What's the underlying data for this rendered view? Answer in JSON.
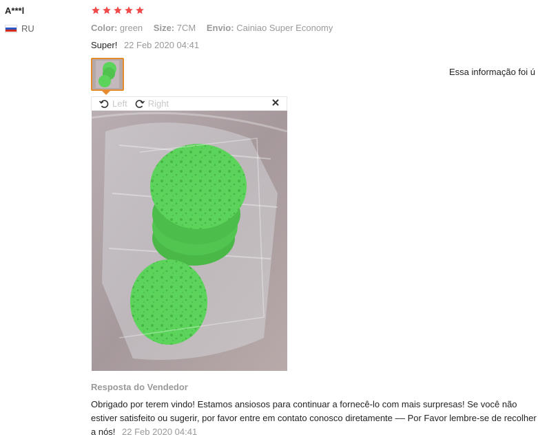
{
  "review": {
    "user_name": "A***l",
    "country": "RU",
    "rating": 5,
    "attributes": [
      {
        "key": "Color:",
        "value": "green"
      },
      {
        "key": "Size:",
        "value": "7CM"
      },
      {
        "key": "Envio:",
        "value": "Cainiao Super Economy"
      }
    ],
    "feedback_text": "Super!",
    "feedback_date": "22 Feb 2020 04:41"
  },
  "helpful_text": "Essa informação foi ú",
  "viewer": {
    "rotate_left_label": "Left",
    "rotate_right_label": "Right"
  },
  "seller_reply": {
    "title": "Resposta do Vendedor",
    "text": "Obrigado por terem vindo! Estamos ansiosos para continuar a fornecê-lo com mais surpresas! Se você não estiver satisfeito ou sugerir, por favor entre em contato conosco diretamente –– Por Favor lembre-se de recolher a nós!",
    "date": "22 Feb 2020 04:41"
  },
  "colors": {
    "star": "#f04a4a",
    "thumb_border": "#e68a2e",
    "muted_text": "#999999",
    "sponge_green": "#5cd35a"
  },
  "icons": {
    "rotate_left": "rotate-left-icon",
    "rotate_right": "rotate-right-icon",
    "close": "close-icon",
    "flag": "russia-flag-icon",
    "star": "star-icon"
  }
}
